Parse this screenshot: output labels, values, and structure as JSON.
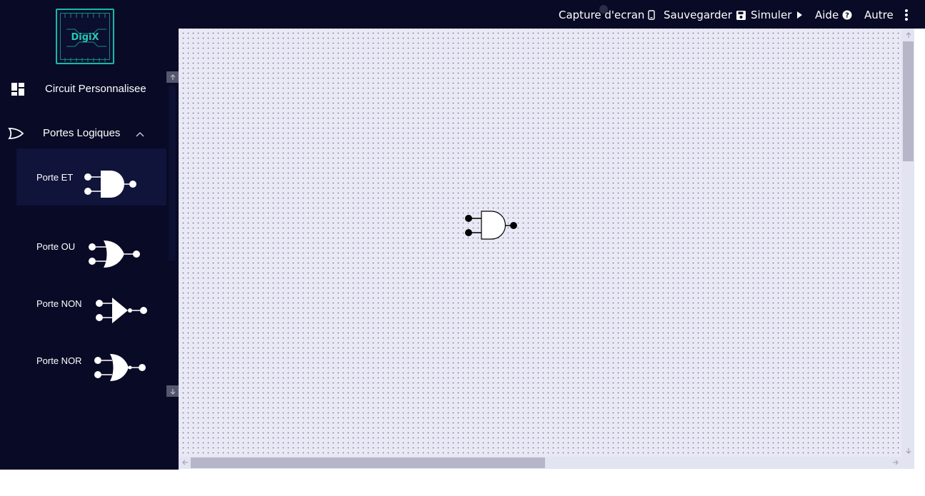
{
  "app": {
    "logo_text": "DigiX"
  },
  "topbar": {
    "screenshot_label": "Capture d'ecran",
    "save_label": "Sauvegarder",
    "simulate_label": "Simuler",
    "help_label": "Aide",
    "more_label": "Autre"
  },
  "sidebar": {
    "custom_circuit_label": "Circuit Personnalisee",
    "gates_section_label": "Portes Logiques",
    "gates": [
      {
        "label": "Porte ET",
        "icon": "and-gate-icon"
      },
      {
        "label": "Porte OU",
        "icon": "or-gate-icon"
      },
      {
        "label": "Porte NON",
        "icon": "not-gate-icon"
      },
      {
        "label": "Porte NOR",
        "icon": "nor-gate-icon"
      }
    ]
  },
  "canvas": {
    "placed_components": [
      {
        "type": "and-gate",
        "icon": "and-gate-icon"
      }
    ]
  },
  "colors": {
    "background_dark": "#080a26",
    "canvas": "#e9e9f6",
    "accent": "#19b9a6"
  }
}
